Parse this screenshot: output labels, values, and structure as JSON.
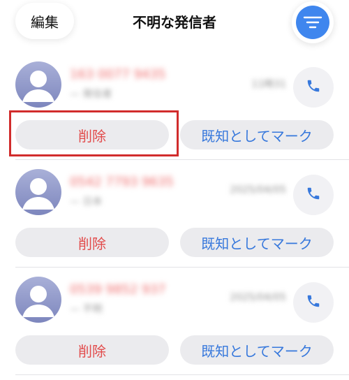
{
  "header": {
    "edit_label": "編集",
    "title": "不明な発信者"
  },
  "icons": {
    "filter": "filter-lines-icon",
    "phone": "phone-icon",
    "avatar": "person-avatar-icon"
  },
  "colors": {
    "accent_blue": "#3f86ee",
    "delete_red": "#e24a4a",
    "mark_blue": "#3778dc",
    "highlight_red": "#d12c2c",
    "pill_background": "#ebebee"
  },
  "calls": [
    {
      "number": "163 0077 9435",
      "subtitle": "— 発信者",
      "date": "11時31",
      "delete_label": "削除",
      "mark_label": "既知としてマーク"
    },
    {
      "number": "0542 7793 9635",
      "subtitle": "— 日本",
      "date": "2025/04/05",
      "delete_label": "削除",
      "mark_label": "既知としてマーク"
    },
    {
      "number": "0539 9852 937",
      "subtitle": "— 不明",
      "date": "2025/04/05",
      "delete_label": "削除",
      "mark_label": "既知としてマーク"
    }
  ]
}
